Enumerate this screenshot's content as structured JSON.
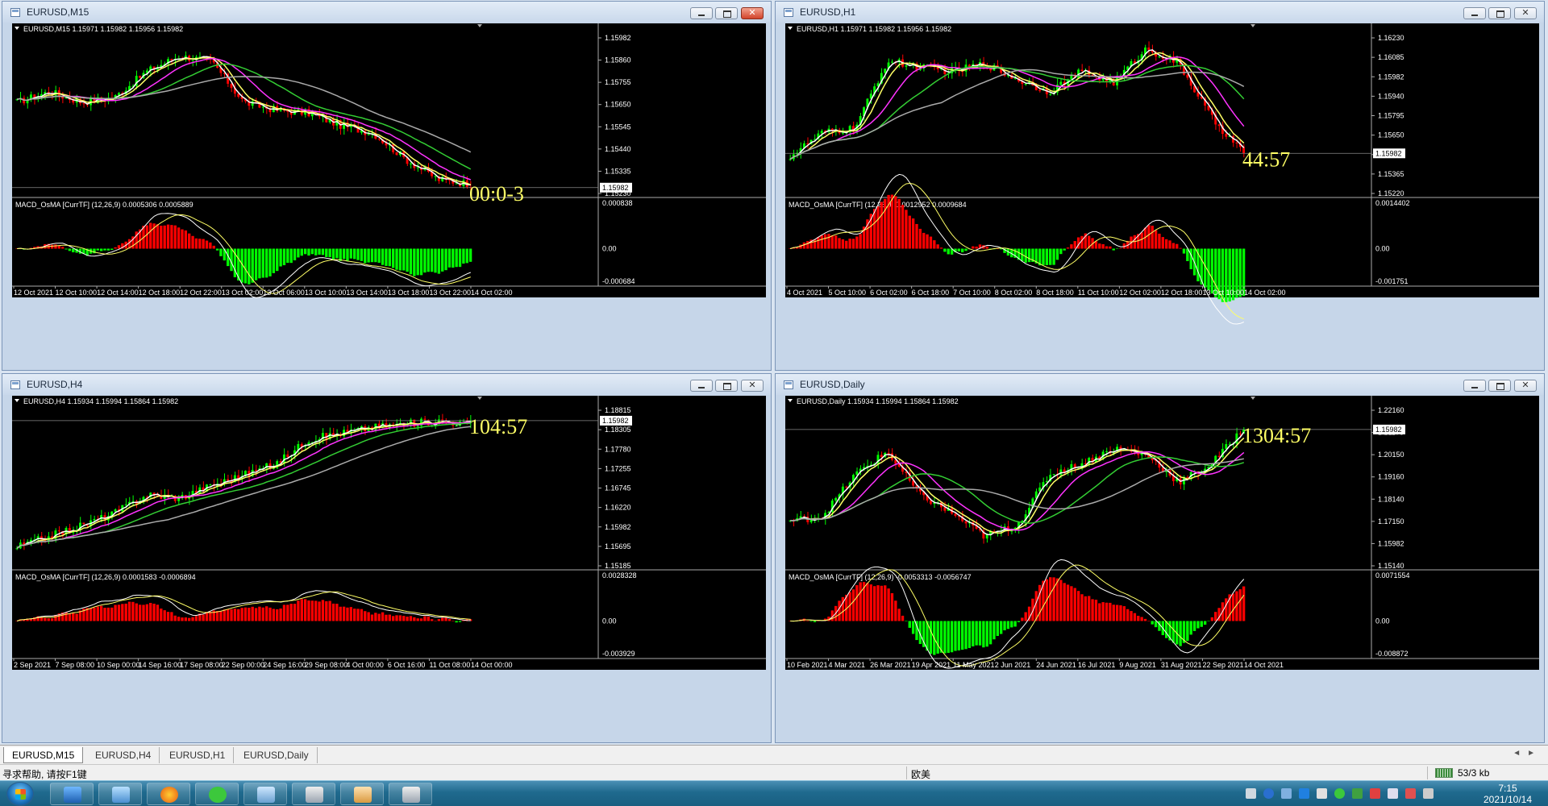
{
  "windows": [
    {
      "id": "m15",
      "title": "EURUSD,M15",
      "info": "EURUSD,M15  1.15971 1.15982 1.15956 1.15982",
      "price_labels": [
        "1.15982",
        "1.15860",
        "1.15755",
        "1.15650",
        "1.15545",
        "1.15440",
        "1.15335",
        "1.15230"
      ],
      "current_price": "1.15982",
      "timer": "00:0-3",
      "macd_info": "MACD_OsMA [CurrTF] (12,26,9) 0.0005306 0.0005889",
      "macd_labels": [
        "0.000838",
        "0.00",
        "-0.000684"
      ],
      "time_labels": [
        "12 Oct 2021",
        "12 Oct 10:00",
        "12 Oct 14:00",
        "12 Oct 18:00",
        "12 Oct 22:00",
        "13 Oct 02:00",
        "13 Oct 06:00",
        "13 Oct 10:00",
        "13 Oct 14:00",
        "13 Oct 18:00",
        "13 Oct 22:00",
        "14 Oct 02:00"
      ],
      "active": true
    },
    {
      "id": "h1",
      "title": "EURUSD,H1",
      "info": "EURUSD,H1  1.15971 1.15982 1.15956 1.15982",
      "price_labels": [
        "1.16230",
        "1.16085",
        "1.15982",
        "1.15940",
        "1.15795",
        "1.15650",
        "1.15510",
        "1.15365",
        "1.15220"
      ],
      "current_price": "1.15982",
      "timer": "44:57",
      "macd_info": "MACD_OsMA [CurrTF] (12,26,9) 0.0012952 0.0009684",
      "macd_labels": [
        "0.0014402",
        "0.00",
        "-0.001751"
      ],
      "time_labels": [
        "4 Oct 2021",
        "5 Oct 10:00",
        "6 Oct 02:00",
        "6 Oct 18:00",
        "7 Oct 10:00",
        "8 Oct 02:00",
        "8 Oct 18:00",
        "11 Oct 10:00",
        "12 Oct 02:00",
        "12 Oct 18:00",
        "13 Oct 10:00",
        "14 Oct 02:00"
      ],
      "active": false
    },
    {
      "id": "h4",
      "title": "EURUSD,H4",
      "info": "EURUSD,H4  1.15934 1.15994 1.15864 1.15982",
      "price_labels": [
        "1.18815",
        "1.18305",
        "1.17780",
        "1.17255",
        "1.16745",
        "1.16220",
        "1.15982",
        "1.15695",
        "1.15185"
      ],
      "current_price": "1.15982",
      "timer": "104:57",
      "macd_info": "MACD_OsMA [CurrTF] (12,26,9) 0.0001583 -0.0006894",
      "macd_labels": [
        "0.0028328",
        "0.00",
        "-0.003929"
      ],
      "time_labels": [
        "2 Sep 2021",
        "7 Sep 08:00",
        "10 Sep 00:00",
        "14 Sep 16:00",
        "17 Sep 08:00",
        "22 Sep 00:00",
        "24 Sep 16:00",
        "29 Sep 08:00",
        "4 Oct 00:00",
        "6 Oct 16:00",
        "11 Oct 08:00",
        "14 Oct 00:00"
      ],
      "active": false
    },
    {
      "id": "daily",
      "title": "EURUSD,Daily",
      "info": "EURUSD,Daily  1.15934 1.15994 1.15864 1.15982",
      "price_labels": [
        "1.22160",
        "1.21170",
        "1.20150",
        "1.19160",
        "1.18140",
        "1.17150",
        "1.15982",
        "1.15140"
      ],
      "current_price": "1.15982",
      "timer": "1304:57",
      "macd_info": "MACD_OsMA [CurrTF] (12,26,9) -0.0053313 -0.0056747",
      "macd_labels": [
        "0.0071554",
        "0.00",
        "-0.008872"
      ],
      "time_labels": [
        "10 Feb 2021",
        "4 Mar 2021",
        "26 Mar 2021",
        "19 Apr 2021",
        "11 May 2021",
        "2 Jun 2021",
        "24 Jun 2021",
        "16 Jul 2021",
        "9 Aug 2021",
        "31 Aug 2021",
        "22 Sep 2021",
        "14 Oct 2021"
      ],
      "active": false
    }
  ],
  "tabs": [
    "EURUSD,M15",
    "EURUSD,H4",
    "EURUSD,H1",
    "EURUSD,Daily"
  ],
  "status": {
    "help": "寻求帮助, 请按F1键",
    "profile": "欧美",
    "connection": "53/3 kb"
  },
  "taskbar": {
    "time": "7:15",
    "date": "2021/10/14"
  },
  "colors": {
    "bull": "#00ff00",
    "bear": "#ff0000",
    "ma_fast": "#ffffff",
    "ma_yellow": "#ffff66",
    "ma_magenta": "#ff33ff",
    "ma_green": "#33cc33",
    "ma_grey": "#aaaaaa",
    "timer": "#ffff66"
  }
}
